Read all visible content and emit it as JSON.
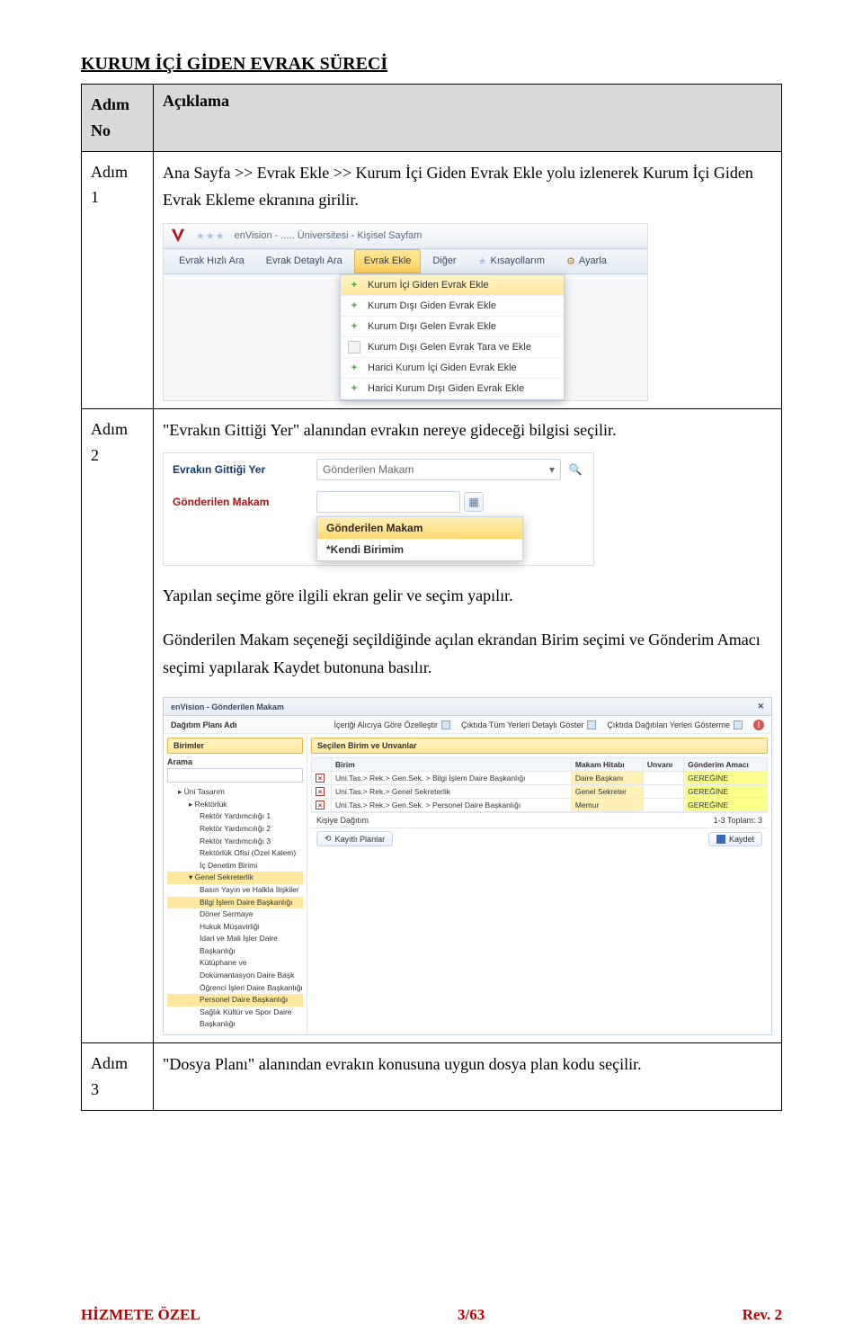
{
  "page": {
    "title": "KURUM İÇİ GİDEN EVRAK SÜRECİ",
    "header_step_col": "Adım\nNo",
    "header_desc_col": "Açıklama",
    "step1_label_a": "Adım",
    "step1_label_b": "1",
    "step1_text": "Ana Sayfa >> Evrak Ekle >> Kurum İçi Giden Evrak Ekle yolu izlenerek Kurum İçi\nGiden Evrak Ekleme ekranına girilir.",
    "step2_label_a": "Adım",
    "step2_label_b": "2",
    "step2_intro": "\"Evrakın Gittiği Yer\" alanından evrakın nereye gideceği bilgisi seçilir.",
    "step2_para1": "Yapılan seçime göre ilgili ekran gelir ve seçim yapılır.",
    "step2_para2": "Gönderilen Makam seçeneği seçildiğinde açılan ekrandan Birim seçimi ve Gönderim Amacı seçimi yapılarak Kaydet butonuna basılır.",
    "step3_label_a": "Adım",
    "step3_label_b": "3",
    "step3_text": "\"Dosya Planı\" alanından evrakın konusuna uygun dosya plan kodu seçilir."
  },
  "sc1": {
    "app_title": "enVision - ..... Üniversitesi - Kişisel Sayfam",
    "stars": "★★★",
    "tabs": {
      "hizli": "Evrak Hızlı Ara",
      "detayli": "Evrak Detaylı Ara",
      "ekle": "Evrak Ekle",
      "diger": "Diğer",
      "kisa": "Kısayollarım",
      "ayarla": "Ayarla"
    },
    "dropdown": {
      "i1": "Kurum İçi Giden Evrak Ekle",
      "i2": "Kurum Dışı Giden Evrak Ekle",
      "i3": "Kurum Dışı Gelen Evrak Ekle",
      "i4": "Kurum Dışı Gelen Evrak Tara ve Ekle",
      "i5": "Harici Kurum İçi Giden Evrak Ekle",
      "i6": "Harici Kurum Dışı Giden Evrak Ekle"
    }
  },
  "sc2": {
    "lab_yer": "Evrakın Gittiği Yer",
    "lab_makam": "Gönderilen Makam",
    "field_value": "Gönderilen Makam",
    "opt_sel": "Gönderilen Makam",
    "opt_kb": "*Kendi Birimim"
  },
  "sc3": {
    "window_title": "enVision - Gönderilen Makam",
    "opt_plan": "Dağıtım Planı Adı",
    "opt_ozel": "İçeriği Alıcıya Göre Özelleştir",
    "opt_tum": "Çıktıda Tüm Yerleri Detaylı Göster",
    "opt_dag": "Çıktıda Dağıtılan Yerleri Gösterme",
    "birimler": "Birimler",
    "arama": "Arama",
    "tree": {
      "uni": "Üni Tasarım",
      "rektorluk": "Rektörlük",
      "ry1": "Rektör Yardımcılığı 1",
      "ry2": "Rektör Yardımcılığı 2",
      "ry3": "Rektör Yardımcılığı 3",
      "ofis": "Rektörlük Ofisi (Özel Kalem)",
      "icd": "İç Denetim Birimi",
      "gs": "Genel Sekreterlik",
      "byhi": "Basın Yayın ve Halkla İlişkiler",
      "bidb": "Bilgi İşlem Daire Başkanlığı",
      "ds": "Döner Sermaye",
      "hm": "Hukuk Müşavirliği",
      "imidb": "İdari ve Mali İşler Daire Başkanlığı",
      "kddb": "Kütüphane ve Dokümantasyon Daire Başk",
      "oidb": "Öğrenci İşleri Daire Başkanlığı",
      "pdb": "Personel Daire Başkanlığı",
      "sksdb": "Sağlık Kültür ve Spor Daire Başkanlığı"
    },
    "secilen": "Seçilen Birim ve Unvanlar",
    "th_birim": "Birim",
    "th_makam": "Makam Hitabı",
    "th_unvan": "Unvanı",
    "th_amac": "Gönderim Amacı",
    "rows": [
      {
        "birim": "Uni.Tas.> Rek.> Gen.Sek. > Bilgi İşlem Daire Başkanlığı",
        "hit": "Daire Başkanı",
        "unvan": "",
        "ga": "GEREĞİNE"
      },
      {
        "birim": "Uni.Tas.> Rek.> Genel Sekreterlik",
        "hit": "Genel Sekreter",
        "unvan": "",
        "ga": "GEREĞİNE"
      },
      {
        "birim": "Uni.Tas.> Rek.> Gen.Sek. > Personel Daire Başkanlığı",
        "hit": "Memur",
        "unvan": "",
        "ga": "GEREĞİNE"
      }
    ],
    "kisiye": "Kişiye Dağıtım",
    "toplam": "1-3 Toplam: 3",
    "kayitli": "Kayıtlı Planlar",
    "kaydet": "Kaydet"
  },
  "footer": {
    "left": "HİZMETE ÖZEL",
    "center": "3/63",
    "right": "Rev. 2"
  }
}
